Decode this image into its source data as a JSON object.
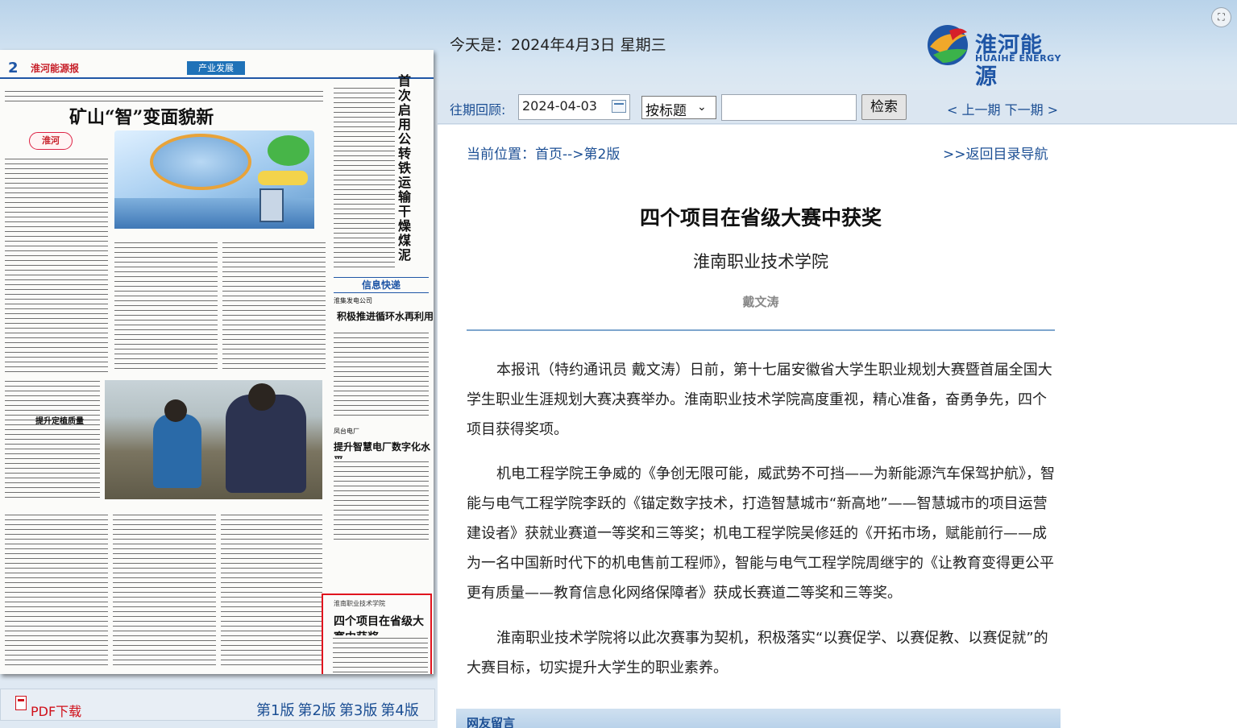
{
  "header": {
    "date_text": "今天是：2024年4月3日 星期三",
    "logo_cn": "淮河能源",
    "logo_en": "HUAIHE ENERGY"
  },
  "newspaper": {
    "page_num": "2",
    "paper_name": "淮河能源报",
    "section": "产业发展",
    "main_headline": "矿山“智”变面貌新",
    "tag": "淮河",
    "vertical_headline": "首次启用公转铁运输干燥煤泥",
    "info_fast": "信息快递",
    "item1_source": "淮集发电公司",
    "item1_headline": "积极推进循环水再利用",
    "item2_source": "凤台电厂",
    "item2_headline": "提升智慧电厂数字化水平",
    "photo_caption": "提升定植质量",
    "highlight_source": "淮南职业技术学院",
    "highlight_headline": "四个项目在省级大赛中获奖"
  },
  "left_footer": {
    "pdf_label": "PDF下载",
    "pages": [
      "第1版",
      "第2版",
      "第3版",
      "第4版"
    ]
  },
  "toolbar": {
    "archive_label": "往期回顾:",
    "date_value": "2024-04-03",
    "select_value": "按标题",
    "keyword_placeholder": "",
    "search_label": "检索",
    "prevnext": "< 上一期 下一期 >"
  },
  "article": {
    "location": "当前位置：首页-->第2版",
    "back_link": ">>返回目录导航",
    "title": "四个项目在省级大赛中获奖",
    "subtitle": "淮南职业技术学院",
    "author": "戴文涛",
    "paragraphs": [
      "本报讯（特约通讯员 戴文涛）日前，第十七届安徽省大学生职业规划大赛暨首届全国大学生职业生涯规划大赛决赛举办。淮南职业技术学院高度重视，精心准备，奋勇争先，四个项目获得奖项。",
      "机电工程学院王争威的《争创无限可能，威武势不可挡——为新能源汽车保驾护航》，智能与电气工程学院李跃的《锚定数字技术，打造智慧城市“新高地”——智慧城市的项目运营建设者》获就业赛道一等奖和三等奖；机电工程学院吴修廷的《开拓市场，赋能前行——成为一名中国新时代下的机电售前工程师》，智能与电气工程学院周继宇的《让教育变得更公平更有质量——教育信息化网络保障者》获成长赛道二等奖和三等奖。",
      "淮南职业技术学院将以此次赛事为契机，积极落实“以赛促学、以赛促教、以赛促就”的大赛目标，切实提升大学生的职业素养。"
    ]
  },
  "comments": {
    "label": "网友留言"
  }
}
